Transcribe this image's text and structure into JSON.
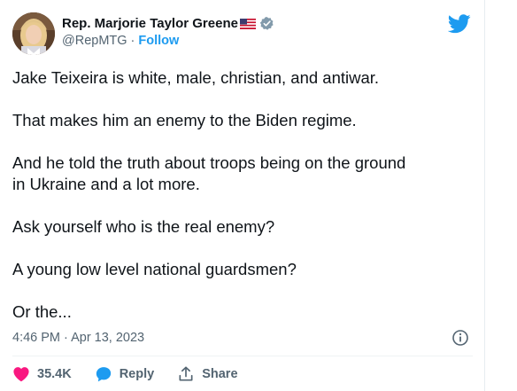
{
  "author": {
    "display_name": "Rep. Marjorie Taylor Greene",
    "handle": "@RepMTG",
    "separator": "·",
    "follow_label": "Follow",
    "flag_icon": "us-flag-icon",
    "verified_icon": "verified-badge-icon"
  },
  "brand": {
    "icon": "twitter-bird-icon",
    "color": "#1d9bf0"
  },
  "tweet": {
    "paragraphs": [
      "Jake Teixeira is white, male, christian, and antiwar.",
      "That makes him an enemy to the Biden regime.",
      "And he told the truth about troops being on the ground\nin Ukraine and a lot more.",
      "Ask yourself who is the real enemy?",
      "A young low level national guardsmen?",
      "Or the..."
    ],
    "timestamp": "4:46 PM · Apr 13, 2023",
    "info_icon": "info-icon"
  },
  "actions": {
    "like_icon": "heart-icon",
    "like_count": "35.4K",
    "like_color": "#f91880",
    "reply_icon": "reply-bubble-icon",
    "reply_label": "Reply",
    "share_icon": "share-icon",
    "share_label": "Share"
  }
}
